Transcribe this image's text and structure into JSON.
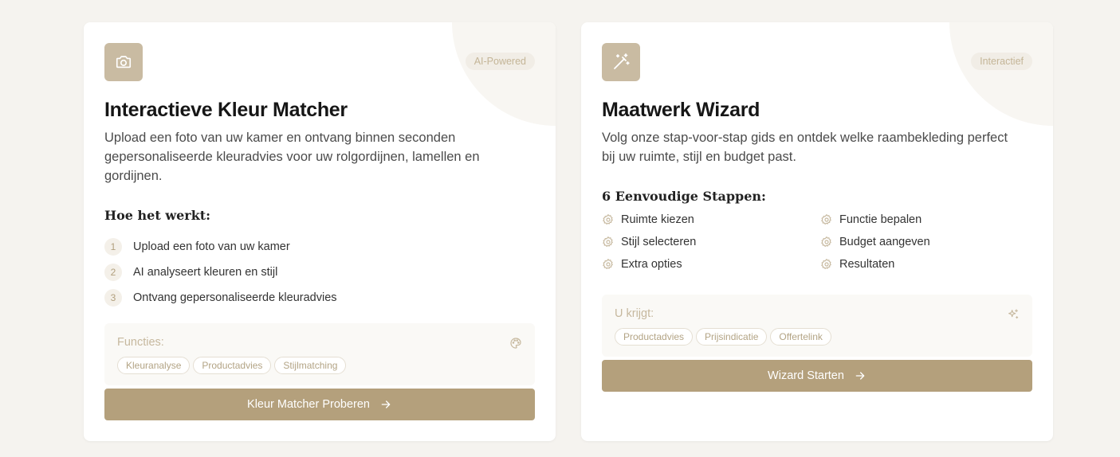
{
  "colors": {
    "accent": "#b4a07c",
    "icon_bg": "#c9bba2",
    "badge_text": "#c4b597",
    "card_bg": "#ffffff",
    "page_bg": "#f5f3ef"
  },
  "color_matcher": {
    "icon": "camera-icon",
    "badge": "AI-Powered",
    "title": "Interactieve Kleur Matcher",
    "description": "Upload een foto van uw kamer en ontvang binnen seconden gepersonaliseerde kleuradvies voor uw rolgordijnen, lamellen en gordijnen.",
    "how_heading": "Hoe het werkt:",
    "steps": [
      {
        "num": "1",
        "text": "Upload een foto van uw kamer"
      },
      {
        "num": "2",
        "text": "AI analyseert kleuren en stijl"
      },
      {
        "num": "3",
        "text": "Ontvang gepersonaliseerde kleuradvies"
      }
    ],
    "features_label": "Functies:",
    "features_icon": "palette-icon",
    "tags": [
      "Kleuranalyse",
      "Productadvies",
      "Stijlmatching"
    ],
    "cta_label": "Kleur Matcher Proberen",
    "cta_icon": "arrow-right-icon"
  },
  "wizard": {
    "icon": "magic-wand-icon",
    "badge": "Interactief",
    "title": "Maatwerk Wizard",
    "description": "Volg onze stap-voor-stap gids en ontdek welke raambekleding perfect bij uw ruimte, stijl en budget past.",
    "steps_heading": "6 Eenvoudige Stappen:",
    "steps": [
      {
        "label": "Ruimte kiezen",
        "icon": "gear-icon"
      },
      {
        "label": "Functie bepalen",
        "icon": "gear-icon"
      },
      {
        "label": "Stijl selecteren",
        "icon": "gear-icon"
      },
      {
        "label": "Budget aangeven",
        "icon": "gear-icon"
      },
      {
        "label": "Extra opties",
        "icon": "gear-icon"
      },
      {
        "label": "Resultaten",
        "icon": "gear-icon"
      }
    ],
    "receive_label": "U krijgt:",
    "receive_icon": "sparkles-icon",
    "tags": [
      "Productadvies",
      "Prijsindicatie",
      "Offertelink"
    ],
    "cta_label": "Wizard Starten",
    "cta_icon": "arrow-right-icon"
  }
}
